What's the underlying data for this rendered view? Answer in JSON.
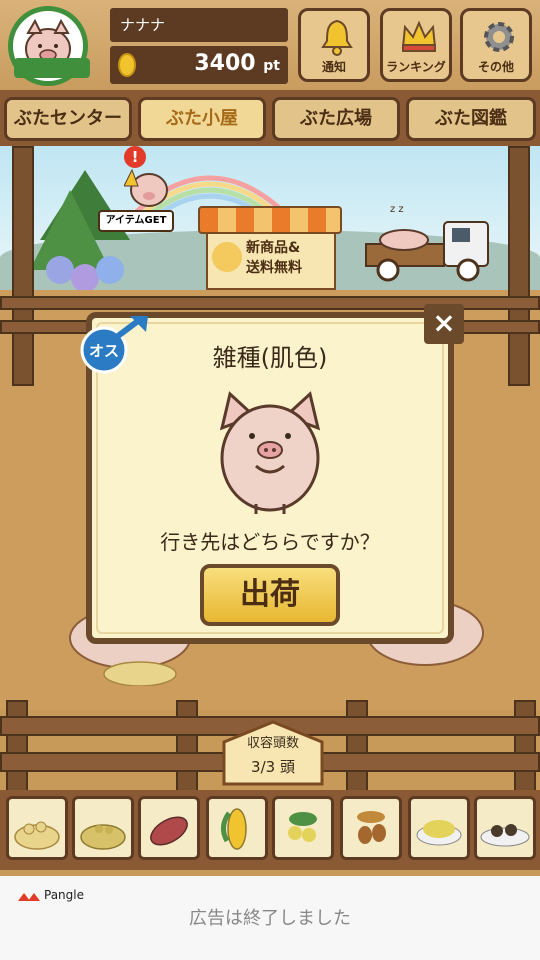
{
  "header": {
    "player_name": "ナナナ",
    "points": "3400",
    "points_unit": "pt",
    "buttons": [
      {
        "label": "通知",
        "icon": "bell-icon"
      },
      {
        "label": "ランキング",
        "icon": "crown-icon"
      },
      {
        "label": "その他",
        "icon": "gear-icon"
      }
    ]
  },
  "tabs": [
    {
      "label": "ぶたセンター",
      "active": false
    },
    {
      "label": "ぶた小屋",
      "active": true
    },
    {
      "label": "ぶた広場",
      "active": false
    },
    {
      "label": "ぶた図鑑",
      "active": false
    }
  ],
  "scene": {
    "item_get_label": "アイテムGET",
    "alert_mark": "!",
    "shop_sign_line1": "新商品&",
    "shop_sign_line2": "送料無料",
    "sleep_mark": "z z"
  },
  "dialog": {
    "gender_label": "オス",
    "gender_symbol": "♂",
    "title": "雑種(肌色)",
    "prompt": "行き先はどちらですか？",
    "ship_button": "出荷",
    "close_symbol": "×"
  },
  "capacity": {
    "label": "収容頭数",
    "value": "3/3 頭"
  },
  "food_items": [
    {
      "name": "soybean-pile-icon"
    },
    {
      "name": "grain-pile-icon"
    },
    {
      "name": "sweet-potato-icon"
    },
    {
      "name": "corn-icon"
    },
    {
      "name": "fruit-icon"
    },
    {
      "name": "acorn-icon"
    },
    {
      "name": "feed-pile-icon"
    },
    {
      "name": "truffle-plate-icon"
    }
  ],
  "ad": {
    "brand": "Pangle",
    "message": "広告は終了しました"
  }
}
